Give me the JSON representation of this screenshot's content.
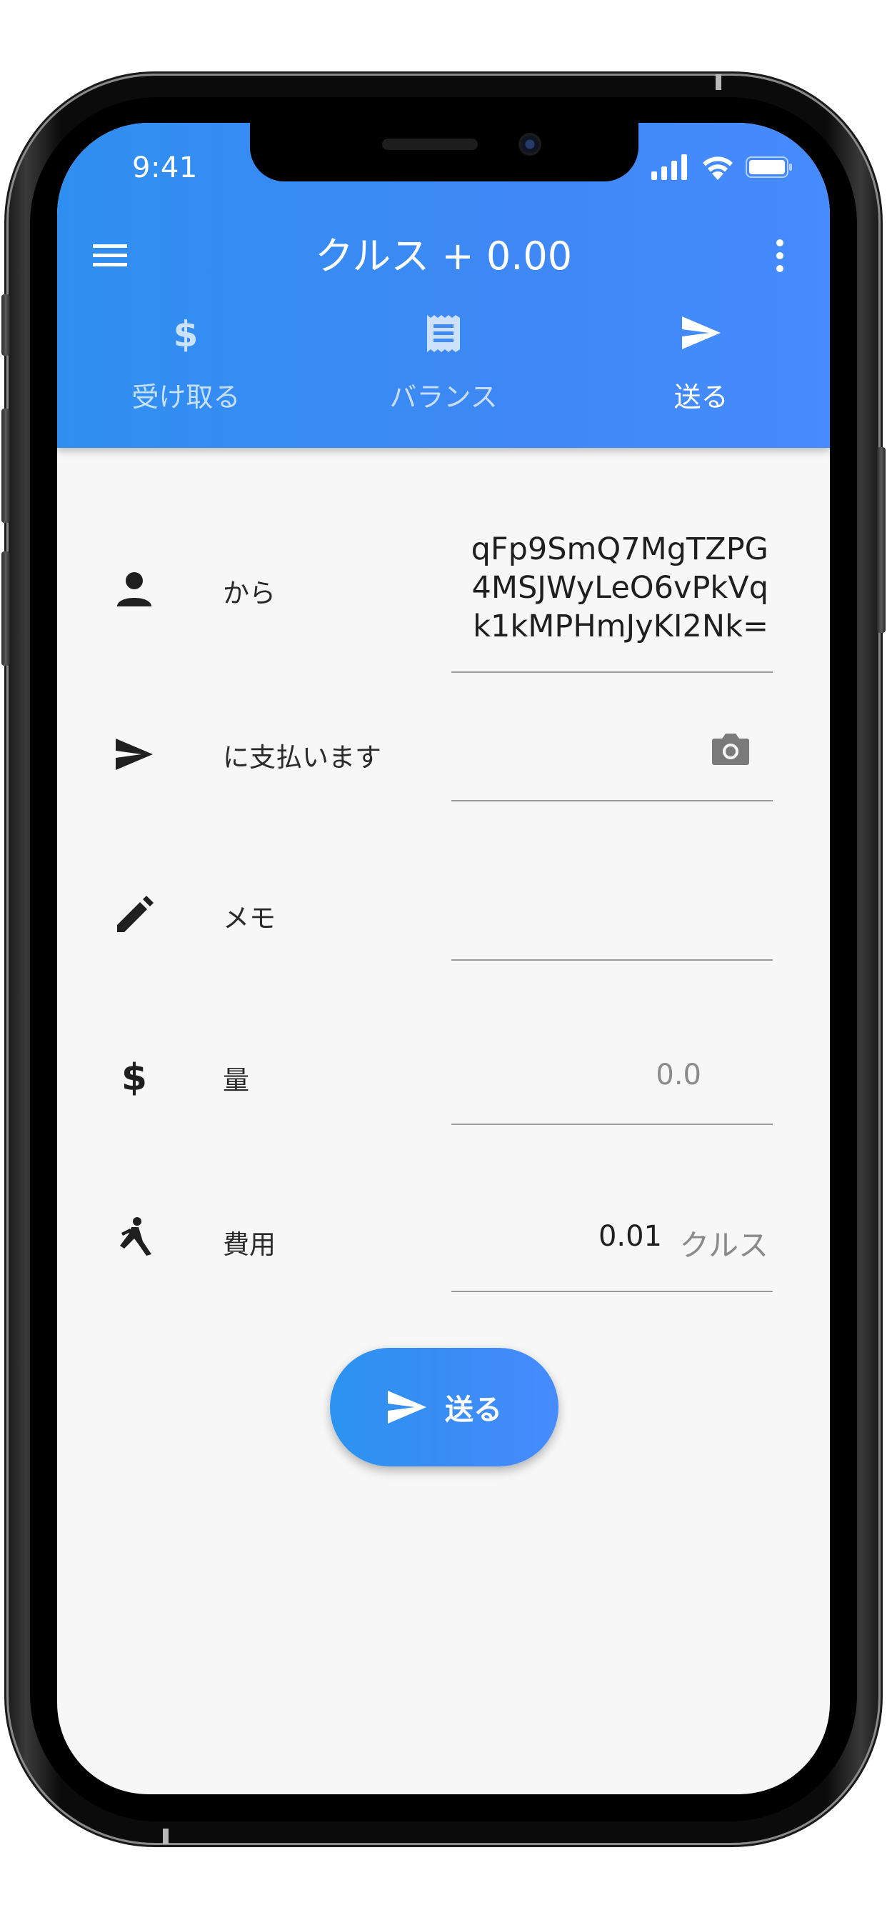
{
  "status_bar": {
    "time": "9:41"
  },
  "app_bar": {
    "title": "クルス + 0.00",
    "tabs": [
      {
        "label": "受け取る",
        "icon": "dollar-icon",
        "active": false
      },
      {
        "label": "バランス",
        "icon": "receipt-icon",
        "active": false
      },
      {
        "label": "送る",
        "icon": "send-icon",
        "active": true
      }
    ]
  },
  "form": {
    "from": {
      "label": "から",
      "icon": "person-icon",
      "value": "qFp9SmQ7MgTZPG\n4MSJWyLeO6vPkVq\nk1kMPHmJyKI2Nk="
    },
    "pay_to": {
      "label": "に支払います",
      "icon": "send-icon",
      "value": "",
      "action_icon": "camera-icon"
    },
    "memo": {
      "label": "メモ",
      "icon": "pencil-icon",
      "value": ""
    },
    "amount": {
      "label": "量",
      "icon": "dollar-icon",
      "placeholder": "0.0"
    },
    "fee": {
      "label": "費用",
      "icon": "walking-icon",
      "value": "0.01",
      "unit": "クルス"
    }
  },
  "send_button": {
    "label": "送る",
    "icon": "send-icon"
  },
  "colors": {
    "app_bar": "#3a8cf4",
    "background": "#f7f7f7",
    "underline": "#9a9a9a"
  }
}
